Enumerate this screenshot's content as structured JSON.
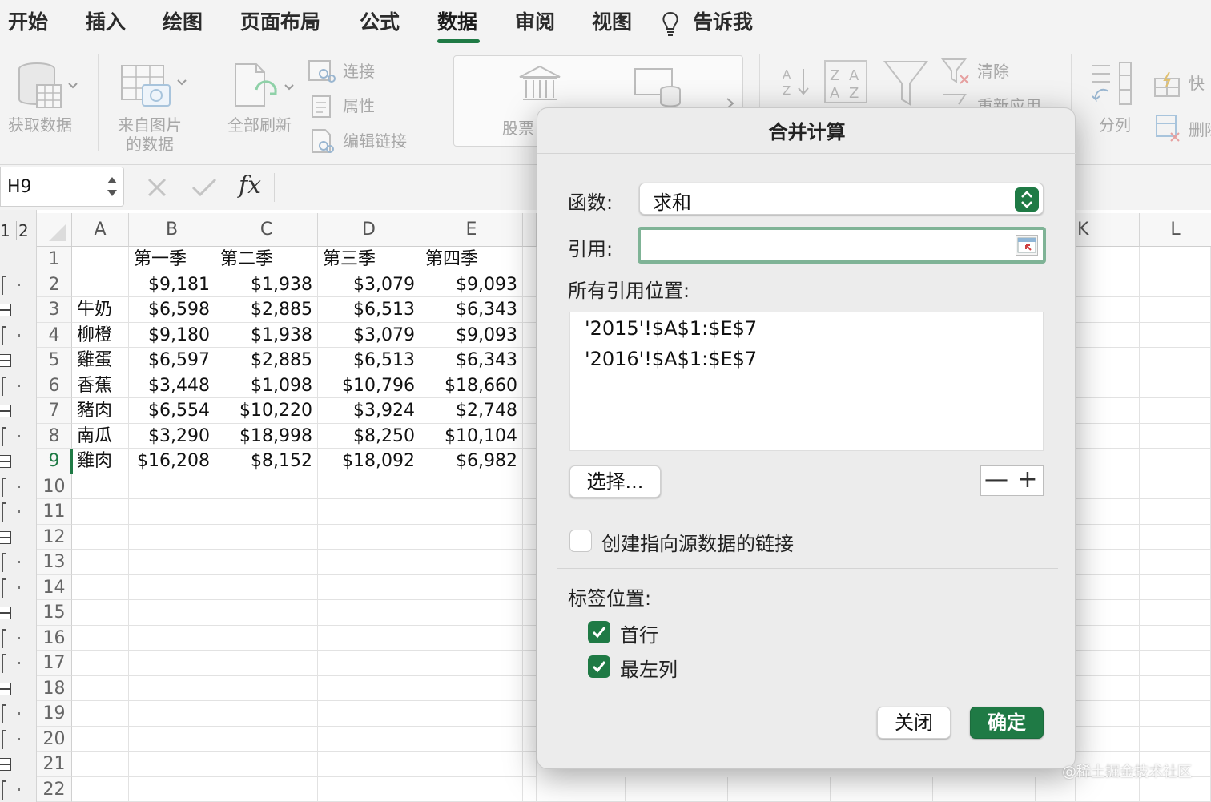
{
  "ribbon_tabs": [
    "开始",
    "插入",
    "绘图",
    "页面布局",
    "公式",
    "数据",
    "审阅",
    "视图",
    "告诉我"
  ],
  "active_tab": "数据",
  "ribbon": {
    "get_data": "获取数据",
    "from_picture_line1": "来自图片",
    "from_picture_line2": "的数据",
    "refresh_all": "全部刷新",
    "connections": "连接",
    "properties": "属性",
    "edit_links": "编辑链接",
    "stocks": "股票",
    "clear": "清除",
    "reapply": "重新应用",
    "text_to_columns": "分列",
    "flash_fill": "快",
    "remove_duplicates": "删除"
  },
  "formula_bar": {
    "name_box": "H9",
    "fx": "fx",
    "formula": ""
  },
  "sheet": {
    "outline_levels": [
      "1",
      "2"
    ],
    "columns": [
      "A",
      "B",
      "C",
      "D",
      "E",
      "K",
      "L"
    ],
    "row_numbers": [
      "1",
      "2",
      "3",
      "4",
      "5",
      "6",
      "7",
      "8",
      "9",
      "10",
      "11",
      "12",
      "13",
      "14",
      "15",
      "16",
      "17",
      "18",
      "19",
      "20",
      "21",
      "22"
    ],
    "selected_row": "9",
    "header_row": [
      "",
      "第一季",
      "第二季",
      "第三季",
      "第四季"
    ],
    "rows": [
      [
        "",
        "$9,181",
        "$1,938",
        "$3,079",
        "$9,093"
      ],
      [
        "牛奶",
        "$6,598",
        "$2,885",
        "$6,513",
        "$6,343"
      ],
      [
        "柳橙",
        "$9,180",
        "$1,938",
        "$3,079",
        "$9,093"
      ],
      [
        "雞蛋",
        "$6,597",
        "$2,885",
        "$6,513",
        "$6,343"
      ],
      [
        "香蕉",
        "$3,448",
        "$1,098",
        "$10,796",
        "$18,660"
      ],
      [
        "豬肉",
        "$6,554",
        "$10,220",
        "$3,924",
        "$2,748"
      ],
      [
        "南瓜",
        "$3,290",
        "$18,998",
        "$8,250",
        "$10,104"
      ],
      [
        "雞肉",
        "$16,208",
        "$8,152",
        "$18,092",
        "$6,982"
      ]
    ]
  },
  "dialog": {
    "title": "合并计算",
    "function_label": "函数:",
    "function_value": "求和",
    "reference_label": "引用:",
    "reference_value": "",
    "all_references_label": "所有引用位置:",
    "all_references": [
      "'2015'!$A$1:$E$7",
      "'2016'!$A$1:$E$7"
    ],
    "browse_button": "选择...",
    "remove_button": "—",
    "add_button": "+",
    "create_links_label": "创建指向源数据的链接",
    "create_links_checked": false,
    "label_position_label": "标签位置:",
    "top_row_label": "首行",
    "top_row_checked": true,
    "left_column_label": "最左列",
    "left_column_checked": true,
    "close_button": "关闭",
    "ok_button": "确定"
  },
  "watermark": "@稀土掘金技术社区",
  "colors": {
    "accent": "#1f7a45",
    "ribbon_bg": "#f3f3f3",
    "dialog_bg": "#ececec"
  }
}
